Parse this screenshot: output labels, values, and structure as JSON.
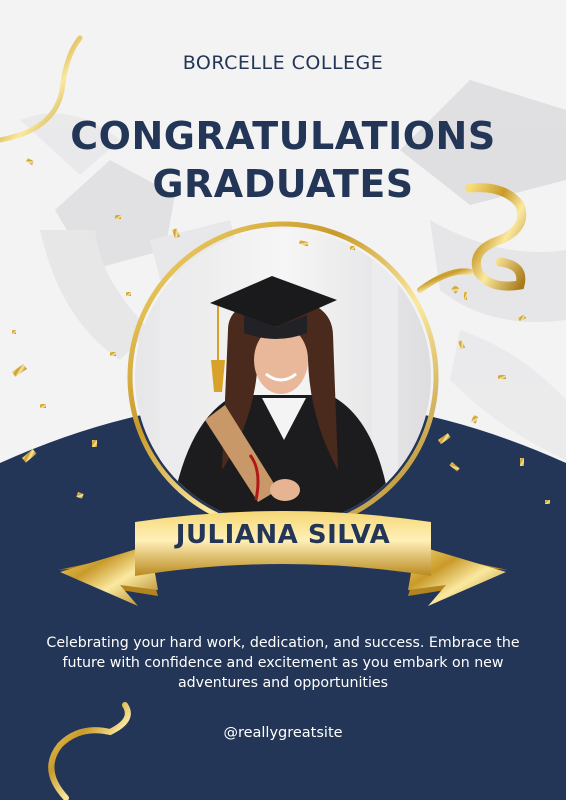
{
  "college": "BORCELLE COLLEGE",
  "headline": {
    "line1": "CONGRATULATIONS",
    "line2": "GRADUATES"
  },
  "graduate_name": "JULIANA SILVA",
  "message": "Celebrating your hard work, dedication, and success. Embrace the future with confidence and excitement as you embark on new adventures and opportunities",
  "website": "@reallygreatsite",
  "colors": {
    "navy": "#243657",
    "gold": "#c9a02e",
    "background": "#f3f3f4"
  },
  "icons": [
    "graduation-cap-icon",
    "diploma-icon",
    "gold-ribbon",
    "confetti"
  ]
}
